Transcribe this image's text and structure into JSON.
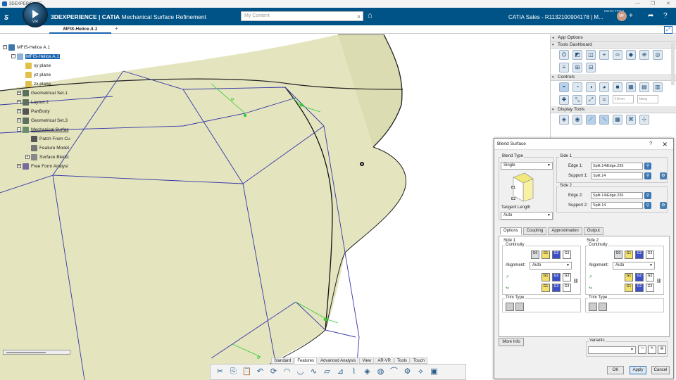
{
  "window": {
    "title": "3DEXPERIENCE"
  },
  "header": {
    "brand": "3DEXPERIENCE | CATIA",
    "app_name": "Mechanical Surface Refinement",
    "compass_version": "V.R",
    "search_placeholder": "My Content",
    "tenant": "CATIA Sales - R1132100904178 | M...",
    "user_name": "Marion FIRTH",
    "avatar_initials": "MF"
  },
  "tabs": {
    "active": "MFIS-Helice A.1",
    "add": "+"
  },
  "tree": {
    "root": "MFIS-Helice A.1",
    "part": "MFIS-Helice A.1",
    "items": [
      "xy plane",
      "yz plane",
      "zx plane",
      "Geometrical Set.1",
      "Layout 2",
      "PartBody",
      "Geometrical Set.3",
      "Mechanical Surfac",
      "Patch From Cu",
      "Feature Model",
      "Surface Blend.",
      "Free Form Analysi"
    ]
  },
  "app_options": {
    "title": "App Options",
    "sections": [
      "Tools Dashboard",
      "Controls",
      "Display Tools"
    ],
    "controls_fields": [
      "10mm",
      "bbeg"
    ]
  },
  "bottom_tabs": [
    "Standard",
    "Features",
    "Advanced Analysis",
    "View",
    "AR-VR",
    "Tools",
    "Touch"
  ],
  "active_bottom_tab": "Features",
  "dialog": {
    "title": "Blend Surface",
    "help": "?",
    "close": "✕",
    "blend_type_label": "Blend Type",
    "blend_type_value": "Single",
    "tangent_length_label": "Tangent Length",
    "tangent_length_value": "Auto",
    "side1_label": "Side 1",
    "side2_label": "Side 2",
    "edge1_label": "Edge 1:",
    "edge1_value": "Split.14\\Edge.235",
    "support1_label": "Support 1:",
    "support1_value": "Split.14",
    "edge2_label": "Edge 2:",
    "edge2_value": "Split.14\\Edge.236",
    "support2_label": "Support 2:",
    "support2_value": "Split.14",
    "tabs": [
      "Options",
      "Coupling",
      "Approximation",
      "Output"
    ],
    "active_tab": "Options",
    "pane_side1": "Side 1",
    "pane_side2": "Side 2",
    "continuity_label": "Continuity",
    "alignment_label": "Alignment:",
    "alignment_value": "Auto",
    "trim_type_label": "Trim Type",
    "continuity_buttons": [
      "G0",
      "G1",
      "G2",
      "G3"
    ],
    "more_info": "More Info",
    "variants_label": "Variants",
    "ok": "OK",
    "apply": "Apply",
    "cancel": "Cancel"
  },
  "colors": {
    "header": "#005386",
    "accent": "#1a63b0",
    "surface": "#e4e5bf",
    "wire": "#3535a8"
  }
}
